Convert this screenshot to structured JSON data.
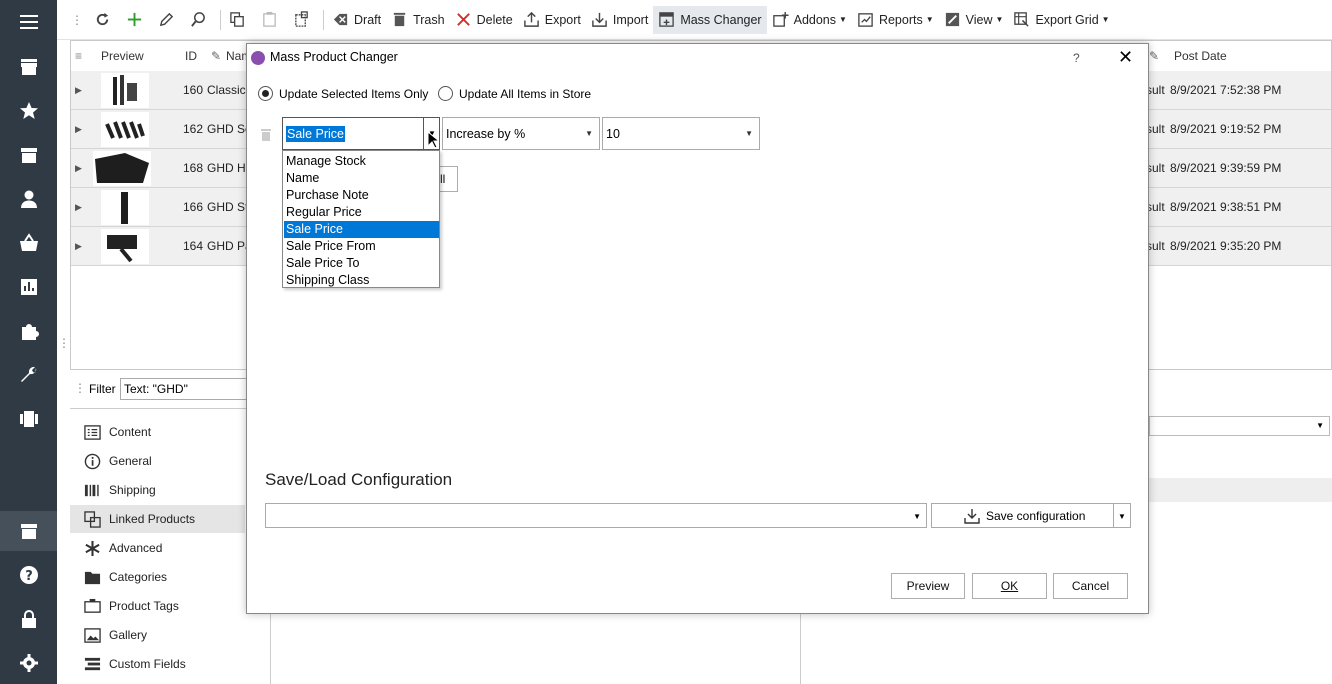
{
  "toolbar": {
    "items": [
      {
        "label": "Draft",
        "icon": "draft-icon"
      },
      {
        "label": "Trash",
        "icon": "trash-icon"
      },
      {
        "label": "Delete",
        "icon": "delete-icon"
      },
      {
        "label": "Export",
        "icon": "export-icon"
      },
      {
        "label": "Import",
        "icon": "import-icon"
      },
      {
        "label": "Mass Changer",
        "icon": "mass-changer-icon"
      },
      {
        "label": "Addons",
        "icon": "addons-icon"
      },
      {
        "label": "Reports",
        "icon": "reports-icon"
      },
      {
        "label": "View",
        "icon": "view-icon"
      },
      {
        "label": "Export Grid",
        "icon": "export-grid-icon"
      }
    ]
  },
  "grid": {
    "headers": {
      "preview": "Preview",
      "id": "ID",
      "name": "Nam",
      "post_date": "Post Date"
    },
    "rows": [
      {
        "id": "160",
        "name": "Classic C",
        "tail": "sult",
        "date": "8/9/2021 7:52:38 PM"
      },
      {
        "id": "162",
        "name": "GHD Se",
        "tail": "sult",
        "date": "8/9/2021 9:19:52 PM"
      },
      {
        "id": "168",
        "name": "GHD He",
        "tail": "sult",
        "date": "8/9/2021 9:39:59 PM"
      },
      {
        "id": "166",
        "name": "GHD Sty",
        "tail": "sult",
        "date": "8/9/2021 9:38:51 PM"
      },
      {
        "id": "164",
        "name": "GHD Pa",
        "tail": "sult",
        "date": "8/9/2021 9:35:20 PM"
      }
    ]
  },
  "filter": {
    "label": "Filter",
    "value": "Text: \"GHD\""
  },
  "panel": {
    "items": [
      {
        "label": "Content",
        "icon": "content-icon"
      },
      {
        "label": "General",
        "icon": "info-icon"
      },
      {
        "label": "Shipping",
        "icon": "shipping-icon"
      },
      {
        "label": "Linked Products",
        "icon": "linked-products-icon"
      },
      {
        "label": "Advanced",
        "icon": "asterisk-icon"
      },
      {
        "label": "Categories",
        "icon": "folder-icon"
      },
      {
        "label": "Product Tags",
        "icon": "tag-icon"
      },
      {
        "label": "Gallery",
        "icon": "gallery-icon"
      },
      {
        "label": "Custom Fields",
        "icon": "custom-fields-icon"
      }
    ]
  },
  "dialog": {
    "title": "Mass Product Changer",
    "help": "?",
    "radio_selected": "Update Selected Items Only",
    "radio_all": "Update All Items in Store",
    "field_value": "Sale Price",
    "operation_value": "Increase by %",
    "amount_value": "10",
    "hidden_button_fragment": "ll",
    "dropdown_options": [
      "Manage Stock",
      "Name",
      "Purchase Note",
      "Regular Price",
      "Sale Price",
      "Sale Price From",
      "Sale Price To",
      "Shipping Class"
    ],
    "dropdown_selected": "Sale Price",
    "save_load_heading": "Save/Load Configuration",
    "save_config_label": "Save configuration",
    "preview_label": "Preview",
    "ok_label": "OK",
    "cancel_label": "Cancel"
  }
}
